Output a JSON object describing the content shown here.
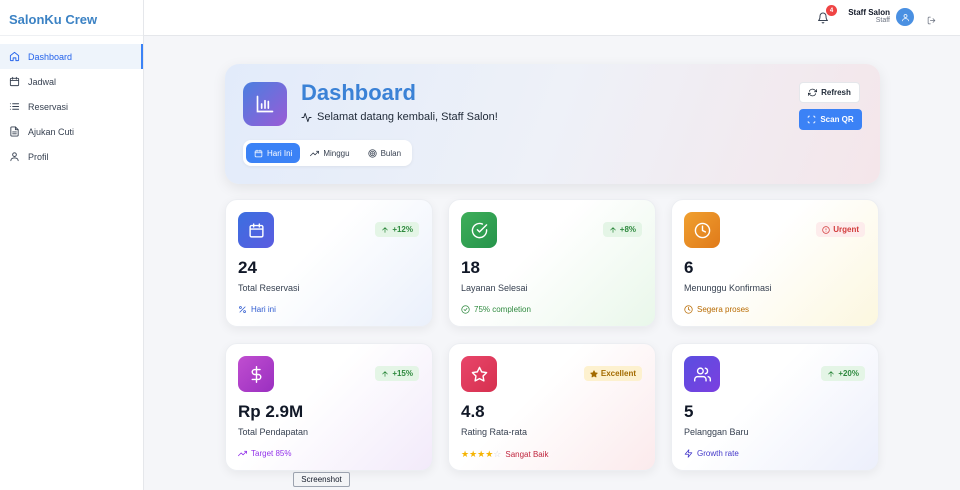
{
  "app": {
    "brand": "SalonKu Crew"
  },
  "sidebar": {
    "items": [
      {
        "label": "Dashboard",
        "icon": "home-icon",
        "active": true
      },
      {
        "label": "Jadwal",
        "icon": "calendar-icon"
      },
      {
        "label": "Reservasi",
        "icon": "list-icon"
      },
      {
        "label": "Ajukan Cuti",
        "icon": "file-icon"
      },
      {
        "label": "Profil",
        "icon": "user-icon"
      }
    ]
  },
  "topbar": {
    "notification_count": "4",
    "user_name": "Staff Salon",
    "user_role": "Staff"
  },
  "hero": {
    "title": "Dashboard",
    "subtitle": "Selamat datang kembali, Staff Salon!",
    "filters": [
      "Hari Ini",
      "Minggu",
      "Bulan"
    ],
    "active_filter": "Hari Ini",
    "refresh_label": "Refresh",
    "scan_label": "Scan QR"
  },
  "cards": [
    {
      "value": "24",
      "label": "Total Reservasi",
      "badge": "+12%",
      "footer": "Hari ini",
      "icon": "calendar-icon",
      "color": "#3b6fe0"
    },
    {
      "value": "18",
      "label": "Layanan Selesai",
      "badge": "+8%",
      "footer": "75% completion",
      "icon": "check-circle-icon",
      "color": "#3eae5a"
    },
    {
      "value": "6",
      "label": "Menunggu Konfirmasi",
      "badge": "Urgent",
      "footer": "Segera proses",
      "icon": "clock-icon",
      "color": "#f0a030"
    },
    {
      "value": "Rp 2.9M",
      "label": "Total Pendapatan",
      "badge": "+15%",
      "footer": "Target 85%",
      "icon": "dollar-icon",
      "color": "#c04ed0"
    },
    {
      "value": "4.8",
      "label": "Rating Rata-rata",
      "badge": "Excellent",
      "footer": "Sangat Baik",
      "icon": "star-icon",
      "color": "#e8466a",
      "rating_stars": 4
    },
    {
      "value": "5",
      "label": "Pelanggan Baru",
      "badge": "+20%",
      "footer": "Growth rate",
      "icon": "users-icon",
      "color": "#5a4ee0"
    }
  ],
  "tooltip": "Screenshot"
}
